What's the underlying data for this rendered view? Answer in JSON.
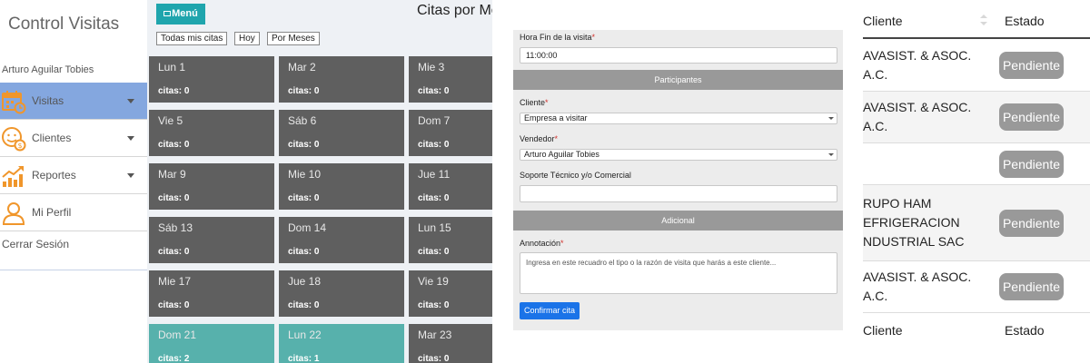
{
  "sidebar": {
    "app_title": "Control Visitas",
    "user_name": "Arturo Aguilar Tobies",
    "items": [
      {
        "label": "Visitas",
        "icon": "calendar-icon",
        "active": true,
        "has_caret": true
      },
      {
        "label": "Clientes",
        "icon": "client-money-icon",
        "active": false,
        "has_caret": true
      },
      {
        "label": "Reportes",
        "icon": "chart-up-icon",
        "active": false,
        "has_caret": true
      },
      {
        "label": "Mi Perfil",
        "icon": "user-icon",
        "active": false,
        "has_caret": false
      }
    ],
    "logout_label": "Cerrar Sesión",
    "accent_color": "#84a7df",
    "icon_color": "#f0962b"
  },
  "calendar": {
    "menu_label": "Menú",
    "title": "Citas por Me",
    "filters": [
      "Todas mis citas",
      "Hoy",
      "Por Meses"
    ],
    "days": [
      {
        "label": "Lun 1",
        "count": "citas: 0"
      },
      {
        "label": "Mar 2",
        "count": "citas: 0"
      },
      {
        "label": "Mie 3",
        "count": "citas: 0"
      },
      {
        "label": "Vie 5",
        "count": "citas: 0"
      },
      {
        "label": "Sáb 6",
        "count": "citas: 0"
      },
      {
        "label": "Dom 7",
        "count": "citas: 0"
      },
      {
        "label": "Mar 9",
        "count": "citas: 0"
      },
      {
        "label": "Mie 10",
        "count": "citas: 0"
      },
      {
        "label": "Jue 11",
        "count": "citas: 0"
      },
      {
        "label": "Sáb 13",
        "count": "citas: 0"
      },
      {
        "label": "Dom 14",
        "count": "citas: 0"
      },
      {
        "label": "Lun 15",
        "count": "citas: 0"
      },
      {
        "label": "Mie 17",
        "count": "citas: 0"
      },
      {
        "label": "Jue 18",
        "count": "citas: 0"
      },
      {
        "label": "Vie 19",
        "count": "citas: 0"
      },
      {
        "label": "Dom 21",
        "count": "citas: 2"
      },
      {
        "label": "Lun 22",
        "count": "citas: 1"
      },
      {
        "label": "Mar 23",
        "count": "citas: 0"
      }
    ],
    "empty_color": "#5f5f5f",
    "busy_color": "#57b1ac",
    "menu_color": "#1fa5ad"
  },
  "form": {
    "end_time_label": "Hora Fin de la visita",
    "end_time_value": "11:00:00",
    "section_participants": "Participantes",
    "client_label": "Cliente",
    "client_value": "Empresa a visitar",
    "seller_label": "Vendedor",
    "seller_value": "Arturo Aguilar Tobies",
    "support_label": "Soporte Técnico y/o Comercial",
    "support_value": "",
    "section_additional": "Adicional",
    "note_label": "Annotación",
    "note_placeholder": "Ingresa en este recuadro el tipo o la razón de visita que harás a este cliente...",
    "required_mark": "*",
    "confirm_label": "Confirmar cita",
    "confirm_color": "#1a73e8"
  },
  "table": {
    "col_client": "Cliente",
    "col_status": "Estado",
    "rows": [
      {
        "client_lines": [
          "AVASIST. & ASOC.",
          "A.C."
        ],
        "status": "Pendiente"
      },
      {
        "client_lines": [
          "AVASIST. & ASOC.",
          "A.C."
        ],
        "status": "Pendiente"
      },
      {
        "client_lines": [],
        "status": "Pendiente"
      },
      {
        "client_lines": [
          "RUPO HAM",
          "EFRIGERACION",
          "NDUSTRIAL SAC"
        ],
        "status": "Pendiente"
      },
      {
        "client_lines": [
          "AVASIST. & ASOC.",
          "A.C."
        ],
        "status": "Pendiente"
      }
    ],
    "badge_color": "#999999"
  }
}
